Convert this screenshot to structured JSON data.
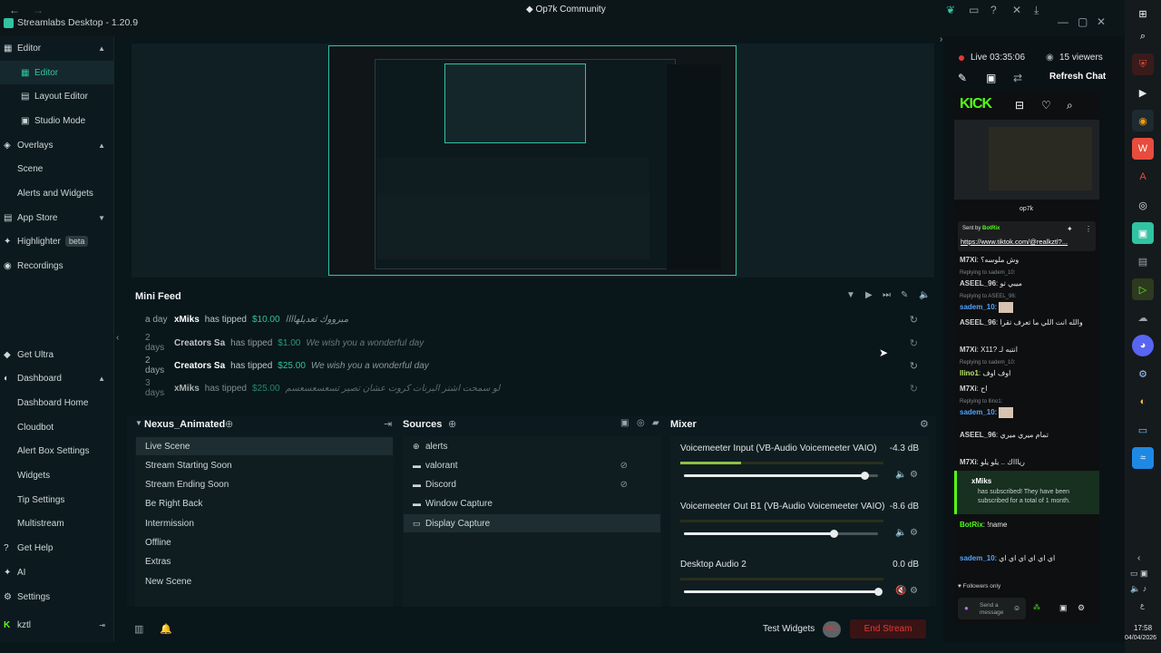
{
  "titlebar": {
    "app_title": "Streamlabs Desktop - 1.20.9",
    "center_title": "Op7k Community"
  },
  "sidebar": {
    "sections": [
      {
        "label": "Editor",
        "items": [
          "Editor",
          "Layout Editor",
          "Studio Mode"
        ]
      },
      {
        "label": "Overlays",
        "items": [
          "Scene",
          "Alerts and Widgets"
        ]
      },
      {
        "label": "App Store"
      },
      {
        "label": "Highlighter",
        "badge": "beta"
      },
      {
        "label": "Recordings"
      }
    ],
    "bottom": [
      {
        "label": "Get Ultra"
      },
      {
        "label": "Dashboard",
        "items": [
          "Dashboard Home",
          "Cloudbot",
          "Alert Box Settings",
          "Widgets",
          "Tip Settings",
          "Multistream"
        ]
      },
      {
        "label": "Get Help"
      },
      {
        "label": "AI"
      },
      {
        "label": "Settings"
      }
    ],
    "user": "kztl"
  },
  "minifeed": {
    "title": "Mini Feed",
    "rows": [
      {
        "time": "a day",
        "user": "xMiks",
        "action": "has tipped",
        "amount": "$10.00",
        "message": "مبرووك تعديلهاااا"
      },
      {
        "time": "2 days",
        "user": "Creators Sa",
        "action": "has tipped",
        "amount": "$1.00",
        "message": "We wish you a wonderful day"
      },
      {
        "time": "2 days",
        "user": "Creators Sa",
        "action": "has tipped",
        "amount": "$25.00",
        "message": "We wish you a wonderful day"
      },
      {
        "time": "3 days",
        "user": "xMiks",
        "action": "has tipped",
        "amount": "$25.00",
        "message": "لو سمحت اشتر البرنات كروت عشان تصير تسعسعسعسم"
      }
    ]
  },
  "scenes": {
    "title": "Nexus_Animated",
    "items": [
      "Live Scene",
      "Stream Starting Soon",
      "Stream Ending Soon",
      "Be Right Back",
      "Intermission",
      "Offline",
      "Extras",
      "New Scene"
    ],
    "selected": 0
  },
  "sources": {
    "title": "Sources",
    "items": [
      "alerts",
      "valorant",
      "Discord",
      "Window Capture",
      "Display Capture"
    ],
    "selected": 4
  },
  "mixer": {
    "title": "Mixer",
    "channels": [
      {
        "name": "Voicemeeter Input (VB-Audio Voicemeeter VAIO)",
        "db": "-4.3 dB",
        "level": 0.3,
        "volume": 0.93
      },
      {
        "name": "Voicemeeter Out B1 (VB-Audio Voicemeeter VAIO)",
        "db": "-8.6 dB",
        "level": 0.0,
        "volume": 0.77
      },
      {
        "name": "Desktop Audio 2",
        "db": "0.0 dB",
        "level": 0.0,
        "volume": 1.0
      }
    ]
  },
  "footer": {
    "test_widgets": "Test Widgets",
    "end_stream": "End Stream"
  },
  "chat": {
    "live": "Live 03:35:06",
    "viewers": "15 viewers",
    "refresh": "Refresh Chat",
    "brand": "KICK",
    "streamer": "op7k",
    "pinned_by": "Sent by",
    "pinned_user": "BotRix",
    "pinned_link": "https://www.tiktok.com/@realkztl?...",
    "messages": [
      {
        "user": "M7Xi",
        "text": "وش ملوسه؟"
      },
      {
        "reply": "Replying to sadem_10:",
        "user": "ASEEL_96",
        "text": "ميبي تو"
      },
      {
        "reply": "Replying to ASEEL_96:",
        "user": "sadem_10",
        "text": ""
      },
      {
        "user": "ASEEL_96",
        "text": "والله انت اللي ما تعرف تقرا"
      },
      {
        "user": "M7Xi",
        "text": "X11? انتبه لـ"
      },
      {
        "reply": "Replying to sadem_10:",
        "user": "llino1",
        "text": "اوف اوف"
      },
      {
        "user": "M7Xi",
        "text": "اح"
      },
      {
        "reply": "Replying to llino1:",
        "user": "sadem_10",
        "text": ""
      },
      {
        "user": "ASEEL_96",
        "text": "تمام ميري ميري"
      },
      {
        "user": "M7Xi",
        "text": "رياااك .. يلو يلو"
      }
    ],
    "sub": {
      "user": "xMiks",
      "text": "has subscribed! They have been subscribed for a total of 1 month."
    },
    "after": [
      {
        "user": "BotRix",
        "text": "!name"
      },
      {
        "user": "sadem_10",
        "text": "اي اي اي اي اي اي"
      }
    ],
    "followers_only": "Followers only",
    "send_placeholder": "Send a message"
  },
  "clock": {
    "time": "17:58",
    "date": "04/04/2026"
  },
  "colors": {
    "accent": "#31c3a2",
    "kick": "#53fc18",
    "live": "#e53935",
    "end_stream": "#c62828"
  }
}
